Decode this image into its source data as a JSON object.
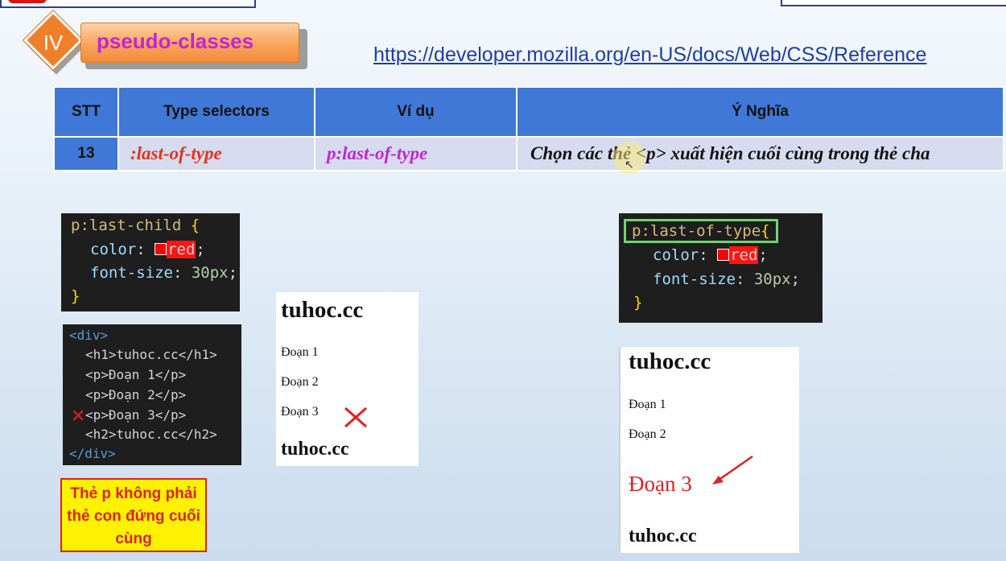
{
  "header": {
    "section_number": "IV",
    "section_title": "pseudo-classes",
    "reference_url": "https://developer.mozilla.org/en-US/docs/Web/CSS/Reference"
  },
  "table": {
    "columns": [
      "STT",
      "Type selectors",
      "Ví dụ",
      "Ý Nghĩa"
    ],
    "rows": [
      {
        "stt": "13",
        "selector": ":last-of-type",
        "example": "p:last-of-type",
        "meaning": "Chọn các thẻ <p> xuất hiện cuối cùng trong thẻ cha"
      }
    ]
  },
  "left_example": {
    "css_code": {
      "selector": "p:last-child",
      "open_brace": "{",
      "prop1": "color",
      "val1": "red",
      "prop2": "font-size",
      "val2": "30px",
      "close_brace": "}"
    },
    "html_code": {
      "lines": [
        "<div>",
        "<h1>tuhoc.cc</h1>",
        "<p>Đoạn 1</p>",
        "<p>Đoạn 2</p>",
        "<p>Đoạn 3</p>",
        "<h2>tuhoc.cc</h2>",
        "</div>"
      ]
    },
    "note": "Thẻ p không phải thẻ con đứng cuối cùng",
    "render": {
      "h1": "tuhoc.cc",
      "p1": "Đoạn 1",
      "p2": "Đoạn 2",
      "p3": "Đoạn 3",
      "h2": "tuhoc.cc"
    },
    "x_mark": "✕"
  },
  "right_example": {
    "css_code": {
      "selector": "p:last-of-type",
      "open_brace": "{",
      "prop1": "color",
      "val1": "red",
      "prop2": "font-size",
      "val2": "30px",
      "close_brace": "}"
    },
    "render": {
      "h1": "tuhoc.cc",
      "p1": "Đoạn 1",
      "p2": "Đoạn 2",
      "p3": "Đoạn 3",
      "h2": "tuhoc.cc"
    }
  },
  "colors": {
    "table_header": "#3f78d6",
    "table_row": "#d7dbef",
    "accent_orange": "#f07f2a",
    "title_magenta": "#c026d3",
    "highlight_red": "#e02020",
    "note_yellow": "#fff200"
  }
}
